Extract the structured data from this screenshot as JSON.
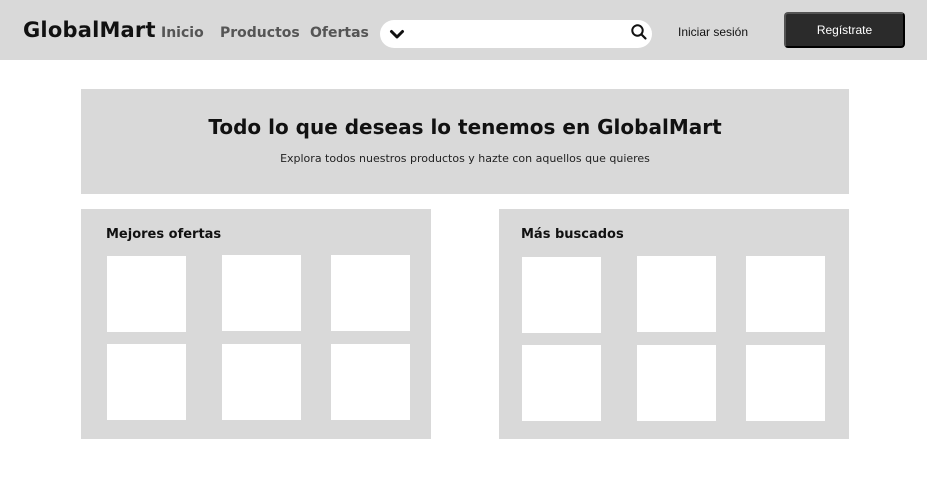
{
  "header": {
    "logo": "GlobalMart",
    "nav": [
      "Inicio",
      "Productos",
      "Ofertas"
    ],
    "search": {
      "value": "",
      "placeholder": "",
      "left_icon": "chevron-down-icon",
      "right_icon": "search-icon"
    },
    "login_label": "Iniciar sesión",
    "register_label": "Regístrate"
  },
  "hero": {
    "title": "Todo lo que deseas lo tenemos en GlobalMart",
    "subtitle": "Explora todos nuestros productos y hazte con aquellos que quieres"
  },
  "sections": [
    {
      "title": "Mejores ofertas",
      "product_count": 6
    },
    {
      "title": "Más buscados",
      "product_count": 6
    }
  ],
  "colors": {
    "surface": "#d9d9d9",
    "primary_button": "#2b2b2b",
    "tile": "#ffffff"
  }
}
